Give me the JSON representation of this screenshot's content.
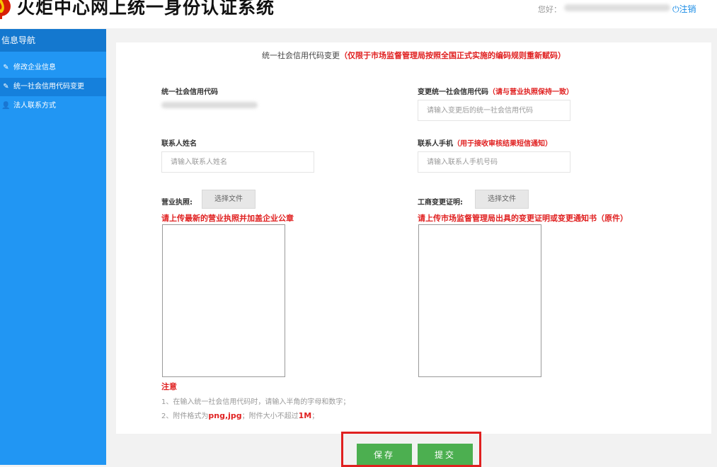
{
  "header": {
    "app_title": "火炬中心网上统一身份认证系统",
    "greeting": "您好：",
    "logout_label": "注销",
    "brand_color": "#e02020"
  },
  "sidebar": {
    "title": "信息导航",
    "items": [
      {
        "label": "修改企业信息",
        "icon": "edit-icon",
        "active": false
      },
      {
        "label": "统一社会信用代码变更",
        "icon": "edit-icon",
        "active": true
      },
      {
        "label": "法人联系方式",
        "icon": "user-icon",
        "active": false
      }
    ]
  },
  "form": {
    "heading": "统一社会信用代码变更",
    "heading_note": "（仅限于市场监督管理局按照全国正式实施的编码规则重新赋码）",
    "credit_code_label": "统一社会信用代码",
    "new_code_label": "变更统一社会信用代码",
    "new_code_note": "（请与营业执照保持一致）",
    "new_code_placeholder": "请输入变更后的统一社会信用代码",
    "contact_name_label": "联系人姓名",
    "contact_name_placeholder": "请输入联系人姓名",
    "contact_phone_label": "联系人手机",
    "contact_phone_note": "（用于接收审核结果短信通知）",
    "contact_phone_placeholder": "请输入联系人手机号码",
    "license_label": "营业执照:",
    "license_button": "选择文件",
    "license_hint": "请上传最新的营业执照并加盖企业公章",
    "change_cert_label": "工商变更证明:",
    "change_cert_button": "选择文件",
    "change_cert_hint": "请上传市场监督管理局出具的变更证明或变更通知书（原件）"
  },
  "notes": {
    "title": "注意",
    "line1": "1、在输入统一社会信用代码时，请输入半角的字母和数字；",
    "line2_prefix": "2、附件格式为",
    "line2_format": "png,jpg",
    "line2_middle": "；附件大小不超过",
    "line2_size": "1M",
    "line2_suffix": "；"
  },
  "actions": {
    "save_label": "保存",
    "submit_label": "提交",
    "button_color": "#4caf50"
  }
}
